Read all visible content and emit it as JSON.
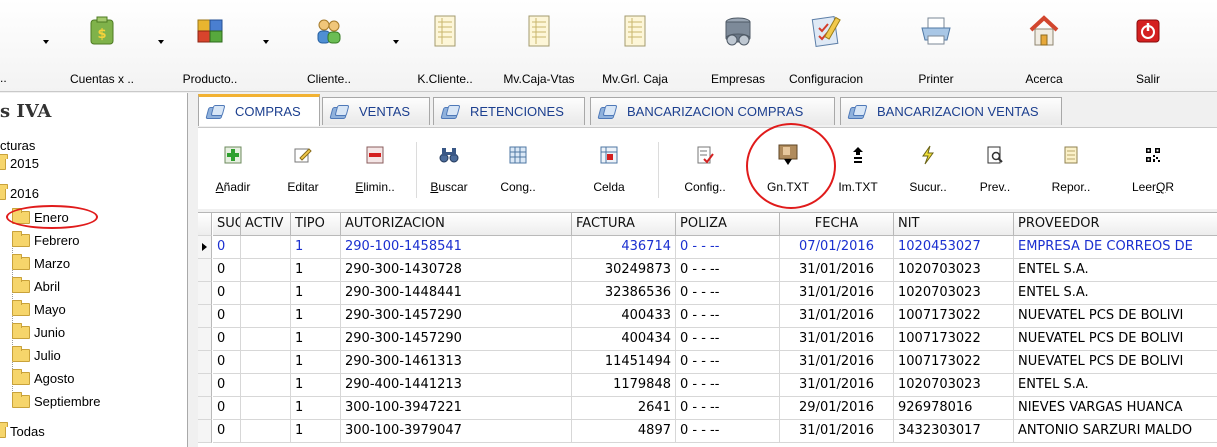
{
  "toolbar": {
    "items": [
      {
        "label": "Cuentas x ..",
        "icon": "money-bag-icon"
      },
      {
        "label": "Producto..",
        "icon": "products-cubes-icon"
      },
      {
        "label": "Cliente..",
        "icon": "clients-people-icon"
      },
      {
        "label": "K.Cliente..",
        "icon": "ledger-document-icon"
      },
      {
        "label": "Mv.Caja-Vtas",
        "icon": "ledger-document-icon"
      },
      {
        "label": "Mv.Grl. Caja",
        "icon": "ledger-document-icon"
      },
      {
        "label": "Empresas",
        "icon": "database-icon"
      },
      {
        "label": "Configuracion",
        "icon": "settings-checklist-icon"
      },
      {
        "label": "Printer",
        "icon": "printer-icon"
      },
      {
        "label": "Acerca",
        "icon": "home-icon"
      },
      {
        "label": "Salir",
        "icon": "power-exit-icon"
      }
    ],
    "first_label": ".."
  },
  "sidebar": {
    "title": "s IVA",
    "root": "cturas",
    "years": [
      "2015",
      "2016"
    ],
    "months": [
      "Enero",
      "Febrero",
      "Marzo",
      "Abril",
      "Mayo",
      "Junio",
      "Julio",
      "Agosto",
      "Septiembre"
    ],
    "all": "Todas"
  },
  "tabs": [
    {
      "label": "COMPRAS",
      "active": true
    },
    {
      "label": "VENTAS",
      "active": false
    },
    {
      "label": "RETENCIONES",
      "active": false
    },
    {
      "label": "BANCARIZACION COMPRAS",
      "active": false
    },
    {
      "label": "BANCARIZACION VENTAS",
      "active": false
    }
  ],
  "actions": [
    {
      "label": "Añadir",
      "underline": "A",
      "rest": "ñadir",
      "icon": "add-icon"
    },
    {
      "label": "Editar",
      "icon": "edit-icon"
    },
    {
      "label": "Elimin..",
      "underline": "E",
      "rest": "limin..",
      "icon": "delete-icon"
    },
    {
      "label": "Buscar",
      "underline": "B",
      "rest": "uscar",
      "icon": "binoculars-icon"
    },
    {
      "label": "Cong..",
      "icon": "freeze-grid-icon"
    },
    {
      "label": "Celda",
      "icon": "cell-grid-icon"
    },
    {
      "label": "Config..",
      "icon": "config-icon"
    },
    {
      "label": "Gn.TXT",
      "icon": "generate-txt-icon"
    },
    {
      "label": "Im.TXT",
      "icon": "import-txt-icon"
    },
    {
      "label": "Sucur..",
      "icon": "lightning-icon"
    },
    {
      "label": "Prev..",
      "icon": "preview-icon"
    },
    {
      "label": "Repor..",
      "icon": "report-icon"
    },
    {
      "label": "LeerQR",
      "underline": "Q",
      "pre": "Leer",
      "rest": "R",
      "icon": "qr-code-icon"
    }
  ],
  "grid": {
    "columns": [
      "SUCU",
      "ACTIV",
      "TIPO",
      "AUTORIZACION",
      "FACTURA",
      "POLIZA",
      "FECHA",
      "NIT",
      "PROVEEDOR"
    ],
    "rows": [
      [
        "0",
        "",
        "1",
        "290-100-1458541",
        "436714",
        "0  -  - --",
        "07/01/2016",
        "1020453027",
        "EMPRESA DE CORREOS DE"
      ],
      [
        "0",
        "",
        "1",
        "290-300-1430728",
        "30249873",
        "0  -  - --",
        "31/01/2016",
        "1020703023",
        "ENTEL S.A."
      ],
      [
        "0",
        "",
        "1",
        "290-300-1448441",
        "32386536",
        "0  -  - --",
        "31/01/2016",
        "1020703023",
        "ENTEL S.A."
      ],
      [
        "0",
        "",
        "1",
        "290-300-1457290",
        "400433",
        "0  -  - --",
        "31/01/2016",
        "1007173022",
        "NUEVATEL PCS DE BOLIVI"
      ],
      [
        "0",
        "",
        "1",
        "290-300-1457290",
        "400434",
        "0  -  - --",
        "31/01/2016",
        "1007173022",
        "NUEVATEL PCS DE BOLIVI"
      ],
      [
        "0",
        "",
        "1",
        "290-300-1461313",
        "11451494",
        "0  -  - --",
        "31/01/2016",
        "1007173022",
        "NUEVATEL PCS DE BOLIVI"
      ],
      [
        "0",
        "",
        "1",
        "290-400-1441213",
        "1179848",
        "0  -  - --",
        "31/01/2016",
        "1020703023",
        "ENTEL S.A."
      ],
      [
        "0",
        "",
        "1",
        "300-100-3947221",
        "2641",
        "0  -  - --",
        "29/01/2016",
        "926978016",
        "NIEVES VARGAS HUANCA"
      ],
      [
        "0",
        "",
        "1",
        "300-100-3979047",
        "4897",
        "0  -  - --",
        "31/01/2016",
        "3432303017",
        "ANTONIO SARZURI MALDO"
      ]
    ]
  },
  "colors": {
    "selected_text": "#1a2fd0",
    "tab_text": "#1c3f8f",
    "active_tab_accent": "#f2b233",
    "annotation_red": "#e01b1b"
  }
}
